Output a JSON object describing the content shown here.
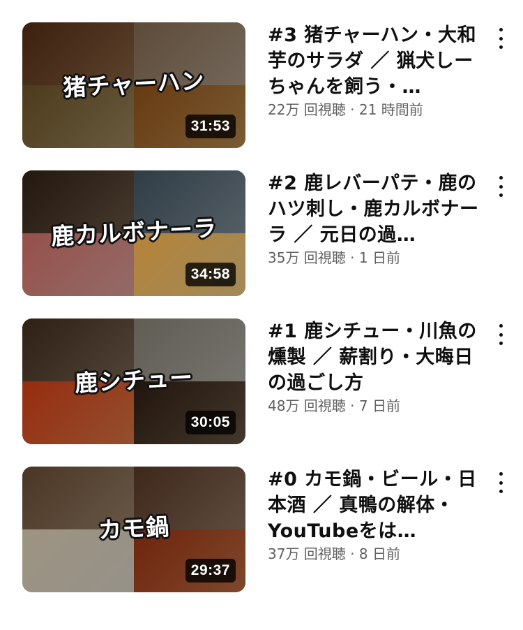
{
  "videos": [
    {
      "thumbnail_text": "猪チャーハン",
      "duration": "31:53",
      "title": "#3 猪チャーハン・大和芋のサラダ ／ 猟犬しーちゃんを飼う・…",
      "views": "22万 回視聴",
      "age": "21 時間前",
      "colors": [
        "#7b5a3c",
        "#9a8a78",
        "#8c7a54",
        "#a27a44"
      ]
    },
    {
      "thumbnail_text": "鹿カルボナーラ",
      "duration": "34:58",
      "title": "#2 鹿レバーパテ・鹿のハツ刺し・鹿カルボナーラ ／ 元日の過…",
      "views": "35万 回視聴",
      "age": "1 日前",
      "colors": [
        "#5e4d3d",
        "#6f7d86",
        "#c48f8a",
        "#d7b778"
      ]
    },
    {
      "thumbnail_text": "鹿シチュー",
      "duration": "30:05",
      "title": "#1 鹿シチュー・川魚の燻製 ／ 薪割り・大晦日の過ごし方",
      "views": "48万 回視聴",
      "age": "7 日前",
      "colors": [
        "#6d5a49",
        "#9c9a92",
        "#c46a3e",
        "#5b4a3a"
      ]
    },
    {
      "thumbnail_text": "カモ鍋",
      "duration": "29:37",
      "title": "#0 カモ鍋・ビール・日本酒 ／ 真鴨の解体・YouTubeをは…",
      "views": "37万 回視聴",
      "age": "8 日前",
      "colors": [
        "#8a7560",
        "#7d6552",
        "#c8c2b6",
        "#a8603a"
      ]
    }
  ],
  "separator": " · ",
  "menu_icon": "more-vert-icon"
}
